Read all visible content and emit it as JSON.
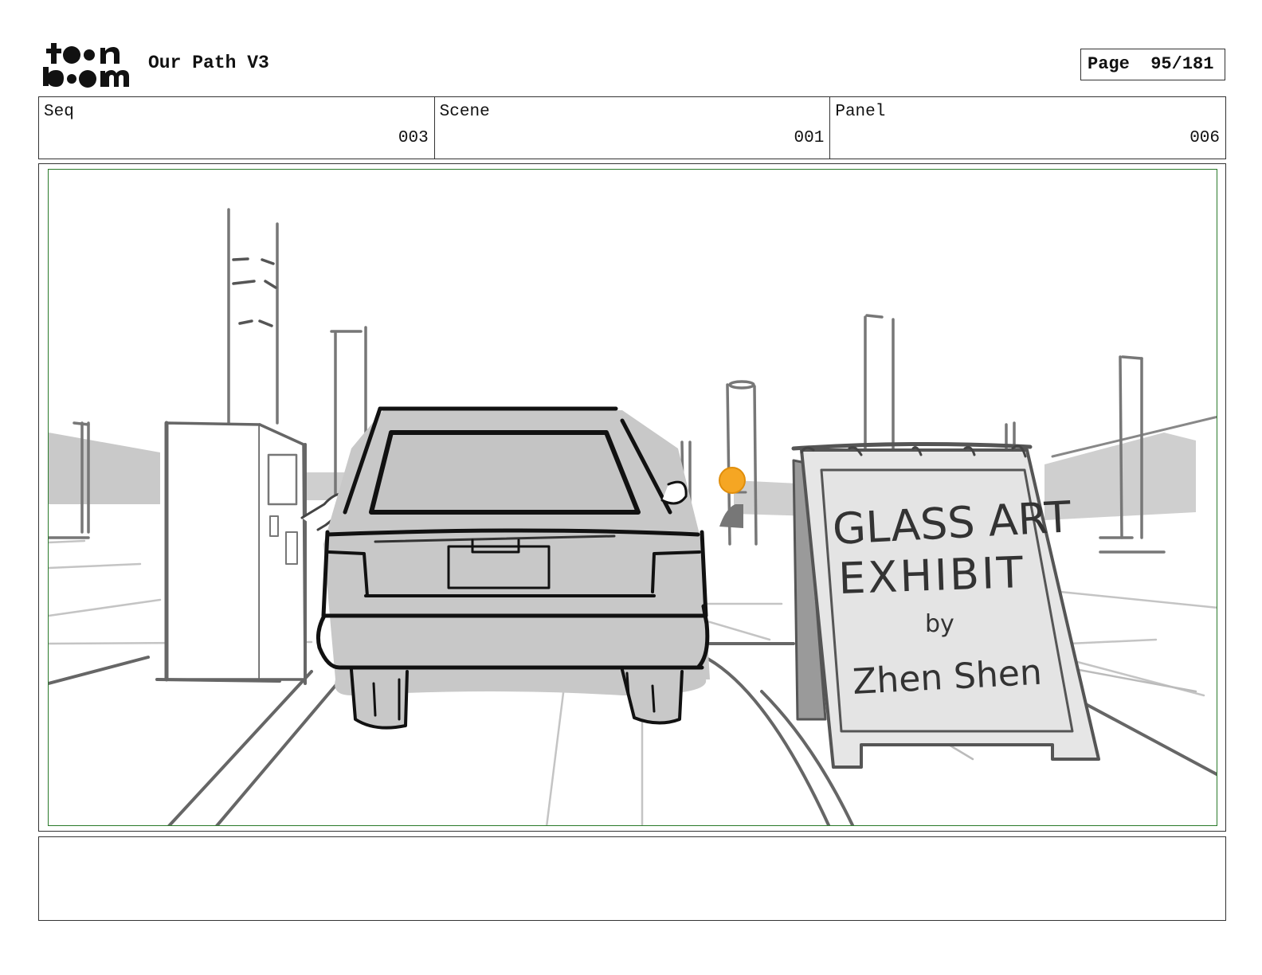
{
  "header": {
    "logo_text": "toon boom",
    "project_title": "Our Path V3",
    "page_label": "Page",
    "page_value": "95/181"
  },
  "meta": {
    "seq_label": "Seq",
    "seq_value": "003",
    "scene_label": "Scene",
    "scene_value": "001",
    "panel_label": "Panel",
    "panel_value": "006"
  },
  "sign": {
    "line1": "GLASS ART",
    "line2": "EXHIBIT",
    "line3": "by",
    "line4": "Zhen Shen"
  },
  "colors": {
    "safe_frame": "#2a7a2a",
    "traffic_light": "#f5a623",
    "car_body": "#c8c8c8"
  },
  "notes": {
    "text": ""
  }
}
